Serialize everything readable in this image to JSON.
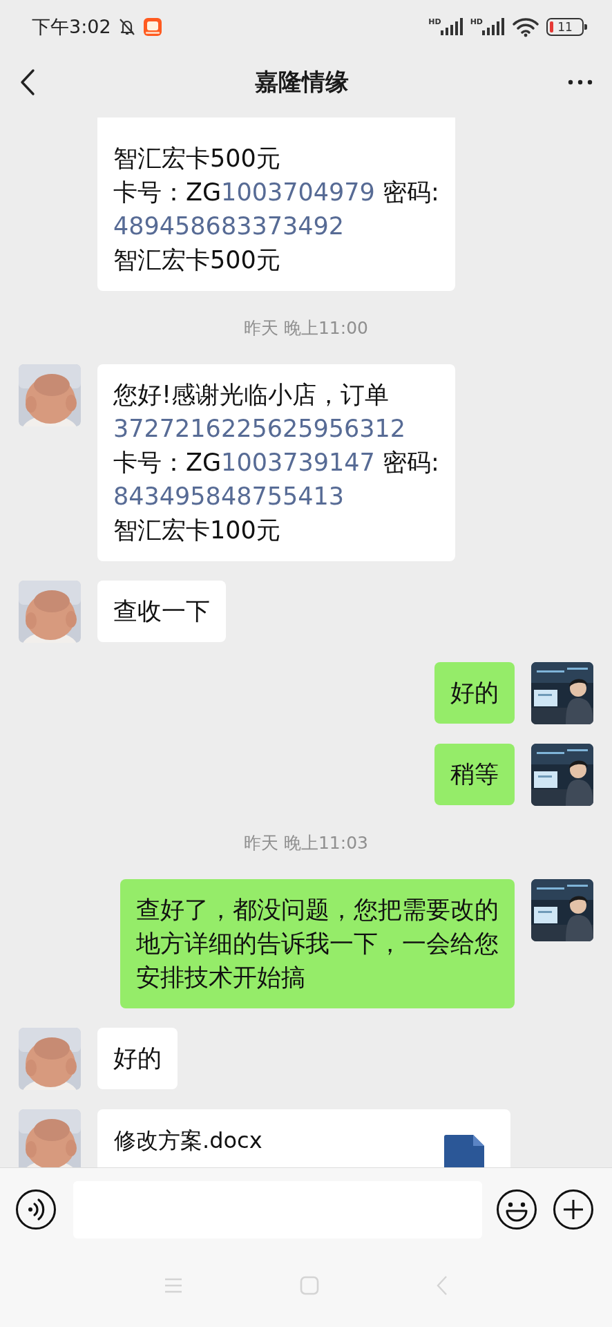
{
  "status_bar": {
    "time": "下午3:02",
    "signals": [
      {
        "label": "HD"
      },
      {
        "label": "HD"
      }
    ],
    "battery": "11"
  },
  "header": {
    "title": "嘉隆情缘"
  },
  "messages": [
    {
      "kind": "text",
      "from_me": false,
      "avatar": false,
      "lines": [
        [
          {
            "kind": "plain",
            "text": "智汇宏卡500元"
          }
        ],
        [
          {
            "kind": "plain",
            "text": "卡号：ZG"
          },
          {
            "kind": "link",
            "text": "1003704979"
          },
          {
            "kind": "plain",
            "text": " 密码:"
          }
        ],
        [
          {
            "kind": "link",
            "text": "489458683373492"
          }
        ],
        [
          {
            "kind": "plain",
            "text": "智汇宏卡500元"
          }
        ]
      ]
    },
    {
      "kind": "timestamp",
      "text": "昨天 晚上11:00"
    },
    {
      "kind": "text",
      "from_me": false,
      "avatar": true,
      "lines": [
        [
          {
            "kind": "plain",
            "text": "您好!感谢光临小店，订单"
          }
        ],
        [
          {
            "kind": "link",
            "text": "3727216225625956312"
          }
        ],
        [
          {
            "kind": "plain",
            "text": "卡号：ZG"
          },
          {
            "kind": "link",
            "text": "1003739147"
          },
          {
            "kind": "plain",
            "text": " 密码:"
          }
        ],
        [
          {
            "kind": "link",
            "text": "843495848755413"
          }
        ],
        [
          {
            "kind": "plain",
            "text": "智汇宏卡100元"
          }
        ]
      ]
    },
    {
      "kind": "text",
      "from_me": false,
      "avatar": true,
      "lines": [
        [
          {
            "kind": "plain",
            "text": "查收一下"
          }
        ]
      ]
    },
    {
      "kind": "text",
      "from_me": true,
      "avatar": true,
      "lines": [
        [
          {
            "kind": "plain",
            "text": "好的"
          }
        ]
      ]
    },
    {
      "kind": "text",
      "from_me": true,
      "avatar": true,
      "lines": [
        [
          {
            "kind": "plain",
            "text": "稍等"
          }
        ]
      ]
    },
    {
      "kind": "timestamp",
      "text": "昨天 晚上11:03"
    },
    {
      "kind": "text",
      "from_me": true,
      "avatar": true,
      "lines": [
        [
          {
            "kind": "plain",
            "text": "查好了，都没问题，您把需要改的"
          }
        ],
        [
          {
            "kind": "plain",
            "text": "地方详细的告诉我一下，一会给您"
          }
        ],
        [
          {
            "kind": "plain",
            "text": "安排技术开始搞"
          }
        ]
      ]
    },
    {
      "kind": "text",
      "from_me": false,
      "avatar": true,
      "lines": [
        [
          {
            "kind": "plain",
            "text": "好的"
          }
        ]
      ]
    },
    {
      "kind": "file",
      "from_me": false,
      "avatar": true,
      "name": "修改方案.docx"
    }
  ]
}
